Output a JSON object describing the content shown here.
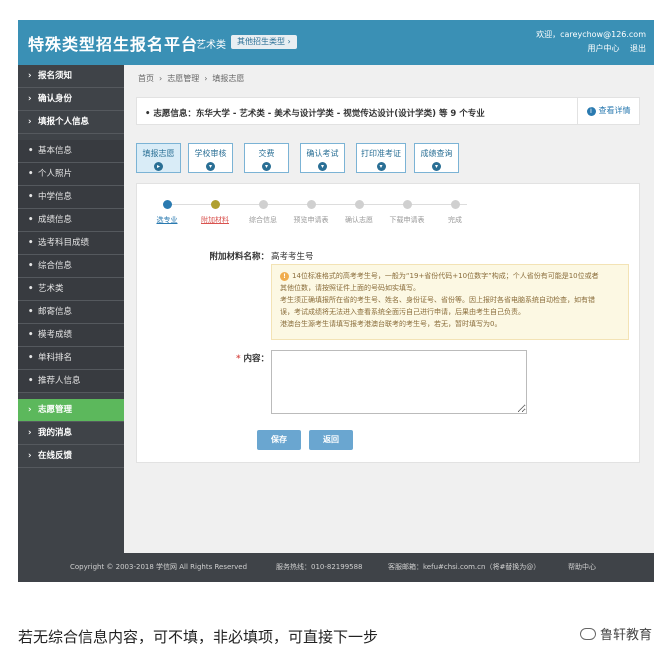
{
  "header": {
    "brand": "特殊类型招生报名平台",
    "category": "艺术类",
    "switch_label": "其他招生类型 ›",
    "welcome": "欢迎，careychow@126.com",
    "user_center": "用户中心",
    "logout": "退出"
  },
  "sidebar": {
    "top": [
      {
        "marker": "›",
        "label": "报名须知"
      },
      {
        "marker": "›",
        "label": "确认身份"
      },
      {
        "marker": "›",
        "label": "填报个人信息"
      }
    ],
    "sub": [
      {
        "marker": "•",
        "label": "基本信息"
      },
      {
        "marker": "•",
        "label": "个人照片"
      },
      {
        "marker": "•",
        "label": "中学信息"
      },
      {
        "marker": "•",
        "label": "成绩信息"
      },
      {
        "marker": "•",
        "label": "选考科目成绩"
      },
      {
        "marker": "•",
        "label": "综合信息"
      },
      {
        "marker": "•",
        "label": "艺术类"
      },
      {
        "marker": "•",
        "label": "邮寄信息"
      },
      {
        "marker": "•",
        "label": "模考成绩"
      },
      {
        "marker": "•",
        "label": "单科排名"
      },
      {
        "marker": "•",
        "label": "推荐人信息"
      }
    ],
    "bottom": [
      {
        "marker": "›",
        "label": "志愿管理"
      },
      {
        "marker": "›",
        "label": "我的消息"
      },
      {
        "marker": "›",
        "label": "在线反馈"
      }
    ]
  },
  "breadcrumb": {
    "home": "首页",
    "sep1": "›",
    "level2": "志愿管理",
    "sep2": "›",
    "current": "填报志愿"
  },
  "info_bar": {
    "text": "•  志愿信息：东华大学 - 艺术类 - 美术与设计学类 - 视觉传达设计(设计学类) 等 9 个专业",
    "detail_label": "查看详情"
  },
  "tabs": [
    {
      "label": "填报志愿",
      "icon": "▸"
    },
    {
      "label": "学校审核",
      "icon": "▾"
    },
    {
      "label": "交费",
      "icon": "▾"
    },
    {
      "label": "确认考试",
      "icon": "▾"
    },
    {
      "label": "打印准考证",
      "icon": "▾"
    },
    {
      "label": "成绩查询",
      "icon": "▾"
    }
  ],
  "steps": [
    {
      "label": "选专业",
      "state": "done"
    },
    {
      "label": "附加材料",
      "state": "current"
    },
    {
      "label": "综合信息",
      "state": "todo"
    },
    {
      "label": "预览申请表",
      "state": "todo"
    },
    {
      "label": "确认志愿",
      "state": "todo"
    },
    {
      "label": "下载申请表",
      "state": "todo"
    },
    {
      "label": "完成",
      "state": "todo"
    }
  ],
  "form": {
    "material_label": "附加材料名称：",
    "material_value": "高考考生号",
    "notice_lines": [
      "14位标准格式的高考考生号，一般为“19+省份代码+10位数字”构成；个人省份有可能是10位或者",
      "其他位数，请按照证件上面的号码如实填写。",
      "考生须正确填报所在省的考生号、姓名、身份证号、省份等。因上报时各省电脑系统自动检查，如有错",
      "误，考试成绩将无法进入查看系统全面污自己进行申请，后果由考生自己负责。",
      "港澳台生源考生请填写报考港澳台联考的考生号，若无，暂时填写为0。"
    ],
    "content_label": "内容：",
    "required_mark": "*",
    "save_label": "保存",
    "back_label": "返回"
  },
  "footer": {
    "copyright": "Copyright © 2003-2018 学信网 All Rights Reserved",
    "hotline": "服务热线：010-82199588",
    "email": "客服邮箱：kefu#chsi.com.cn（将#替换为@）",
    "help": "帮助中心"
  },
  "caption": "若无综合信息内容，可不填，非必填项，可直接下一步",
  "watermark": "鲁轩教育"
}
